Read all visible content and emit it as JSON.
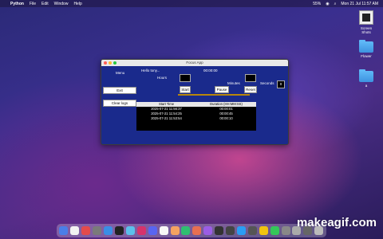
{
  "menubar": {
    "app": "Python",
    "items": [
      "File",
      "Edit",
      "Window",
      "Help"
    ],
    "battery": "55%",
    "clock": "Mon 21 Jul  11:57 AM"
  },
  "desktop": [
    {
      "label": "Screen Shots",
      "kind": "screenshot-icon"
    },
    {
      "label": "Flower",
      "kind": "folder-icon"
    },
    {
      "label": "a",
      "kind": "folder-icon"
    }
  ],
  "window": {
    "title": "Focus App",
    "menu_label": "Menu",
    "greeting": "Hello tony...",
    "timer": "00:00:00",
    "hours_label": "Hours",
    "minutes_label": "Minutes",
    "seconds_label": "Seconds",
    "seconds_value": "0",
    "exit": "Exit",
    "clear_logs": "Clear logs",
    "start": "Start",
    "pause": "Pause",
    "reset": "Reset",
    "log_headers": [
      "Start Time",
      "Duration (HH:MM:SS)"
    ],
    "log_rows": [
      [
        "2025-07-21 11:56:37",
        "00:00:01"
      ],
      [
        "2025-07-21 11:54:25",
        "00:00:45"
      ],
      [
        "2025-07-21 11:53:54",
        "00:00:10"
      ]
    ]
  },
  "watermark": "makeagif.com",
  "dock_colors": [
    "#4a7ee8",
    "#f2f2f2",
    "#e34b4b",
    "#7a7a7a",
    "#3a8ee6",
    "#222",
    "#5bc0eb",
    "#d6336c",
    "#5865f2",
    "#f7f7f7",
    "#f4a261",
    "#2fbf71",
    "#e76f51",
    "#9b5de5",
    "#333",
    "#444",
    "#2a9df4",
    "#555",
    "#f1c40f",
    "#34c759",
    "#888",
    "#aaa",
    "#666",
    "#bbb"
  ]
}
